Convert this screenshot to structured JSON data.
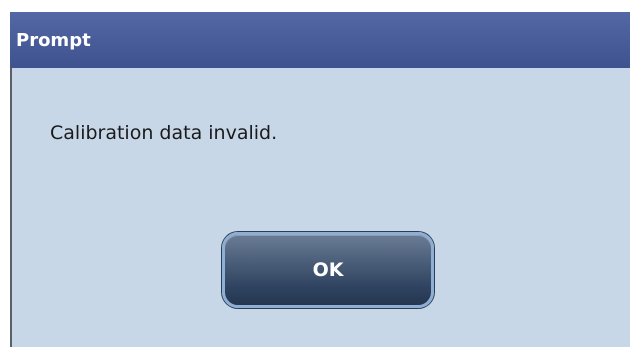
{
  "dialog": {
    "title": "Prompt",
    "message": "Calibration data invalid.",
    "ok_label": "OK"
  },
  "colors": {
    "titlebar": "#4b5e9c",
    "body_background": "#c7d7e7",
    "button_face": "#3a4d6a",
    "button_border": "#8eaed3"
  }
}
